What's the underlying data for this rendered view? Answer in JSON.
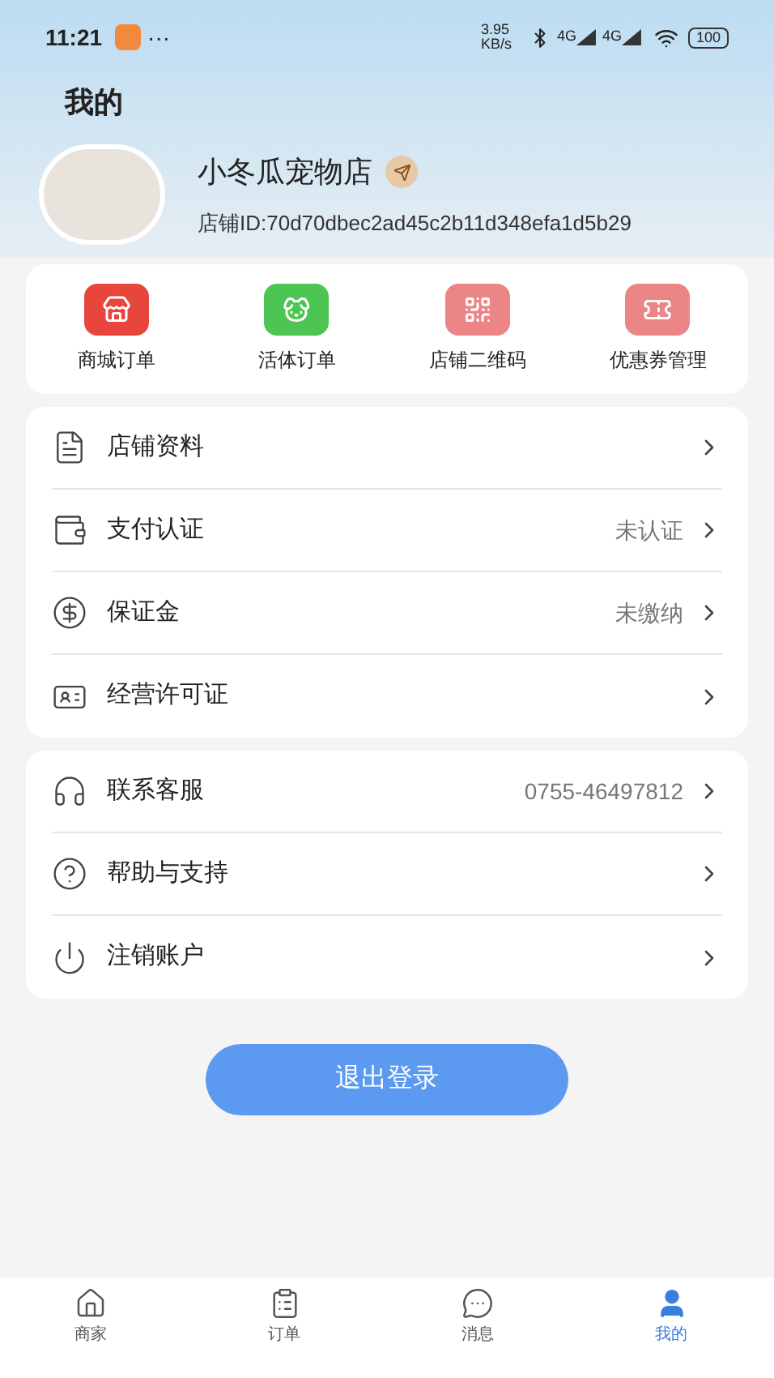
{
  "status_bar": {
    "time": "11:21",
    "more": "···",
    "speed": "3.95 KB/s",
    "network_1": "4G",
    "network_2": "4G",
    "battery": "100"
  },
  "title": "我的",
  "profile": {
    "name": "小冬瓜宠物店",
    "store_id": "店铺ID:70d70dbec2ad45c2b11d348efa1d5b29"
  },
  "shortcuts": [
    {
      "kind": "store",
      "label": "商城订单",
      "color": "#e8463c"
    },
    {
      "kind": "dog",
      "label": "活体订单",
      "color": "#4cc552"
    },
    {
      "kind": "qr",
      "label": "店铺二维码",
      "color": "#ec8585"
    },
    {
      "kind": "coupon",
      "label": "优惠券管理",
      "color": "#ec8585"
    }
  ],
  "menu_groups": [
    [
      {
        "kind": "document",
        "label": "店铺资料"
      },
      {
        "kind": "wallet",
        "label": "支付认证",
        "value": "未认证"
      },
      {
        "kind": "deposit",
        "label": "保证金",
        "value": "未缴纳"
      },
      {
        "kind": "license",
        "label": "经营许可证"
      }
    ],
    [
      {
        "kind": "headset",
        "label": "联系客服",
        "value": "0755-46497812"
      },
      {
        "kind": "help",
        "label": "帮助与支持"
      },
      {
        "kind": "power",
        "label": "注销账户"
      }
    ]
  ],
  "logout_button": "退出登录",
  "tabs": [
    {
      "kind": "home",
      "label": "商家",
      "selected": false
    },
    {
      "kind": "orders",
      "label": "订单",
      "selected": false
    },
    {
      "kind": "messages",
      "label": "消息",
      "selected": false
    },
    {
      "kind": "profile",
      "label": "我的",
      "selected": true
    }
  ]
}
